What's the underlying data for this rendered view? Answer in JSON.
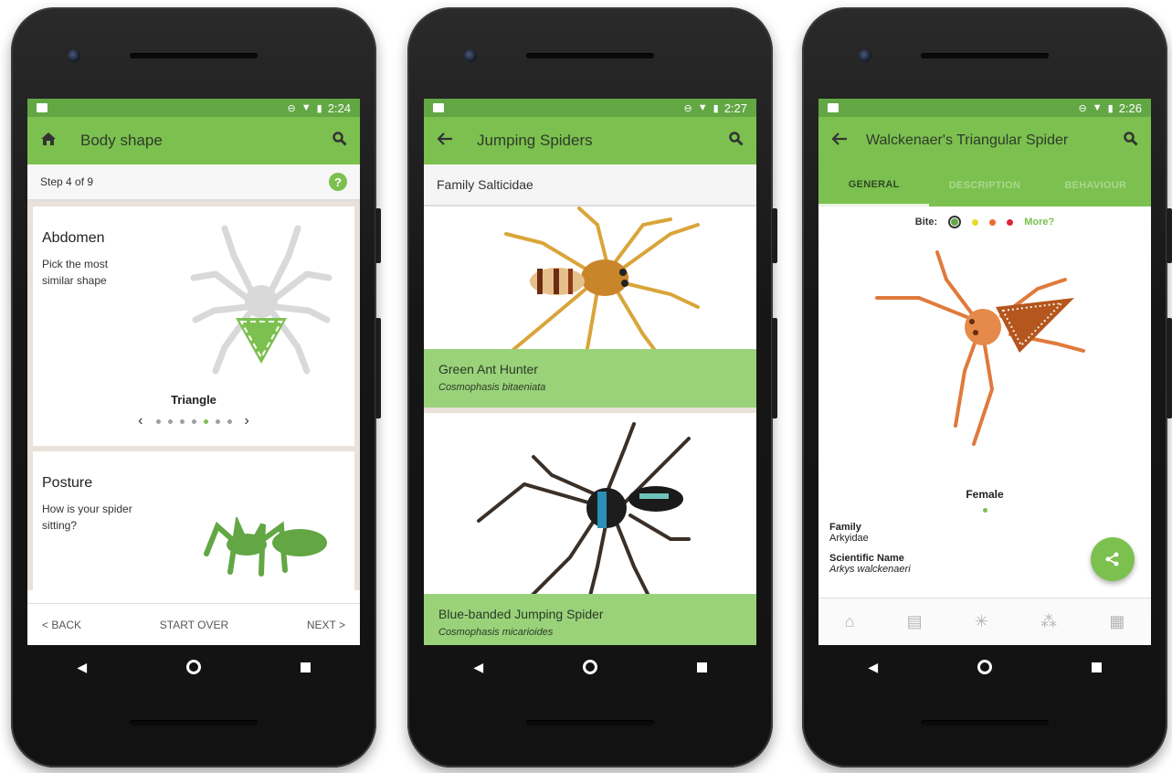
{
  "phones": [
    {
      "status_time": "2:24",
      "appbar": {
        "lead_icon": "home-icon",
        "title": "Body shape",
        "trail_icon": "search-icon"
      },
      "step": "Step 4 of 9",
      "help_label": "?",
      "abdomen": {
        "title": "Abdomen",
        "subtitle": "Pick the most similar shape",
        "choice": "Triangle",
        "choice_index": 5,
        "choice_total": 7
      },
      "posture": {
        "title": "Posture",
        "subtitle": "How is your spider sitting?"
      },
      "actions": {
        "back": "< BACK",
        "start_over": "START OVER",
        "next": "NEXT >"
      }
    },
    {
      "status_time": "2:27",
      "appbar": {
        "lead_icon": "back-arrow-icon",
        "title": "Jumping Spiders",
        "trail_icon": "search-icon"
      },
      "family": "Family Salticidae",
      "species": [
        {
          "name": "Green Ant Hunter",
          "scientific": "Cosmophasis bitaeniata"
        },
        {
          "name": "Blue-banded Jumping Spider",
          "scientific": "Cosmophasis micarioides"
        }
      ]
    },
    {
      "status_time": "2:26",
      "appbar": {
        "lead_icon": "back-arrow-icon",
        "title": "Walckenaer's Triangular Spider",
        "trail_icon": "search-icon"
      },
      "tabs": [
        "GENERAL",
        "DESCRIPTION",
        "BEHAVIOUR"
      ],
      "bite": {
        "label": "Bite:",
        "more": "More?",
        "colors": [
          "#62a744",
          "#e6dc2a",
          "#ee6a2a",
          "#d9263a"
        ]
      },
      "image_caption": "Female",
      "facts": [
        {
          "key": "Family",
          "value": "Arkyidae",
          "italic": false
        },
        {
          "key": "Scientific Name",
          "value": "Arkys walckenaeri",
          "italic": true
        }
      ],
      "bottom_nav": [
        "home-icon",
        "book-icon",
        "spider-icon",
        "ant-icon",
        "grid-icon"
      ]
    }
  ],
  "system_nav": {
    "back": "◀",
    "home": "home",
    "recents": "recents"
  },
  "colors": {
    "brand_green": "#7cc04f",
    "status_green": "#62a744",
    "caption_green": "#9ad27a"
  }
}
